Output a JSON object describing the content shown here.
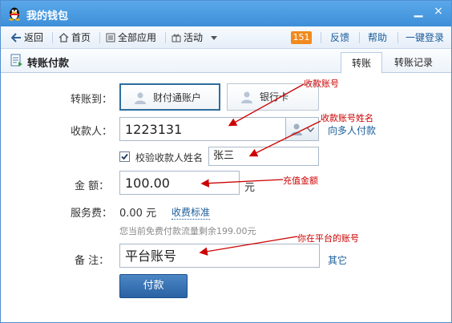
{
  "window": {
    "title": "我的钱包",
    "minimize_glyph": "▁",
    "close_glyph": "×"
  },
  "toolbar": {
    "back": "返回",
    "home": "首页",
    "all_apps": "全部应用",
    "activity": "活动",
    "badge": "151",
    "feedback": "反馈",
    "help": "帮助",
    "one_click_login": "一键登录"
  },
  "page": {
    "title": "转账付款",
    "tabs": [
      {
        "label": "转账",
        "active": true
      },
      {
        "label": "转账记录",
        "active": false
      }
    ]
  },
  "form": {
    "transfer_to_label": "转账到：",
    "account_options": [
      {
        "label": "财付通账户",
        "selected": true
      },
      {
        "label": "银行卡",
        "selected": false
      }
    ],
    "payee_label": "收款人：",
    "payee_value": "1223131",
    "multi_payee_link": "向多人付款",
    "verify_label": "校验收款人姓名",
    "verify_checked": true,
    "verify_name_value": "张三",
    "amount_label": "金  额：",
    "amount_value": "100.00",
    "amount_unit": "元",
    "fee_label": "服务费：",
    "fee_value": "0.00 元",
    "fee_standard_link": "收费标准",
    "free_quota_hint": "您当前免费付款流量剩余199.00元",
    "remark_label": "备  注：",
    "remark_value": "平台账号",
    "remark_other_link": "其它",
    "submit_label": "付款"
  },
  "annotations": {
    "payee_account_note": "收款账号",
    "payee_name_note": "收款账号姓名",
    "amount_note": "充值金额",
    "remark_note": "你在平台的账号"
  },
  "colors": {
    "title_bar": "#3d8fd8",
    "badge": "#f08a1e",
    "annotation": "#cc0000",
    "submit": "#2a62a4",
    "link": "#1a5c9a"
  }
}
